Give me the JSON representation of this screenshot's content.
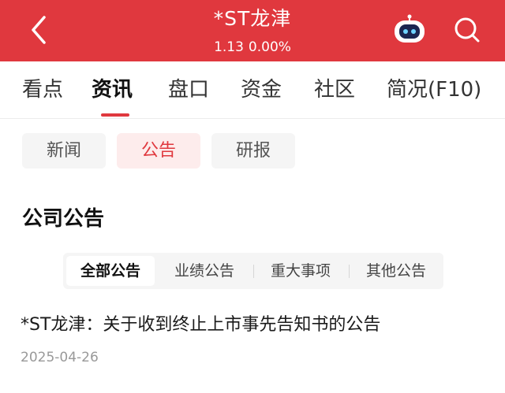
{
  "header": {
    "title": "*ST龙津",
    "price": "1.13",
    "change": "0.00%",
    "back_icon": "chevron-left-icon",
    "assistant_icon": "robot-icon",
    "search_icon": "search-icon",
    "bg_color": "#e0383e"
  },
  "tabs": [
    {
      "label": "看点"
    },
    {
      "label": "资讯",
      "active": true
    },
    {
      "label": "盘口"
    },
    {
      "label": "资金"
    },
    {
      "label": "社区"
    },
    {
      "label": "简况(F10)"
    }
  ],
  "chips": [
    {
      "label": "新闻"
    },
    {
      "label": "公告",
      "active": true
    },
    {
      "label": "研报"
    }
  ],
  "section": {
    "title": "公司公告"
  },
  "filters": [
    {
      "label": "全部公告",
      "active": true
    },
    {
      "label": "业绩公告"
    },
    {
      "label": "重大事项"
    },
    {
      "label": "其他公告"
    }
  ],
  "announcements": [
    {
      "title": "*ST龙津：关于收到终止上市事先告知书的公告",
      "date": "2025-04-26"
    }
  ]
}
